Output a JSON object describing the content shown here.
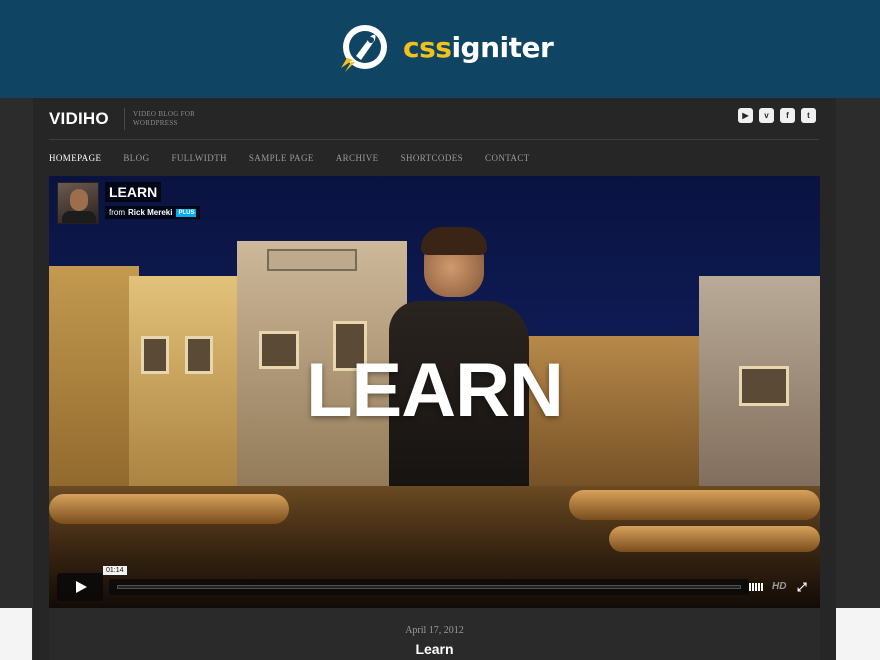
{
  "banner": {
    "logo_part_a": "css",
    "logo_part_b": "igniter",
    "logo_icon": "rocket-icon",
    "colors": {
      "background": "#0f4463",
      "accent": "#f2c11b"
    }
  },
  "site": {
    "brand": "VIDIHO",
    "tagline": "VIDEO BLOG FOR WORDPRESS",
    "social_icons": [
      "youtube-icon",
      "vimeo-icon",
      "facebook-icon",
      "twitter-icon"
    ],
    "nav": [
      {
        "label": "HOMEPAGE",
        "active": true
      },
      {
        "label": "BLOG"
      },
      {
        "label": "FULLWIDTH"
      },
      {
        "label": "SAMPLE PAGE"
      },
      {
        "label": "ARCHIVE"
      },
      {
        "label": "SHORTCODES"
      },
      {
        "label": "CONTACT"
      }
    ]
  },
  "video": {
    "title": "LEARN",
    "overlay_title": "LEARN",
    "from_prefix": "from",
    "author": "Rick Mereki",
    "author_badge": "PLUS",
    "timecode": "01:14",
    "quality": "HD",
    "icons": [
      "play-icon",
      "volume-icon",
      "fullscreen-icon"
    ]
  },
  "post": {
    "date": "April 17, 2012",
    "title": "Learn"
  }
}
